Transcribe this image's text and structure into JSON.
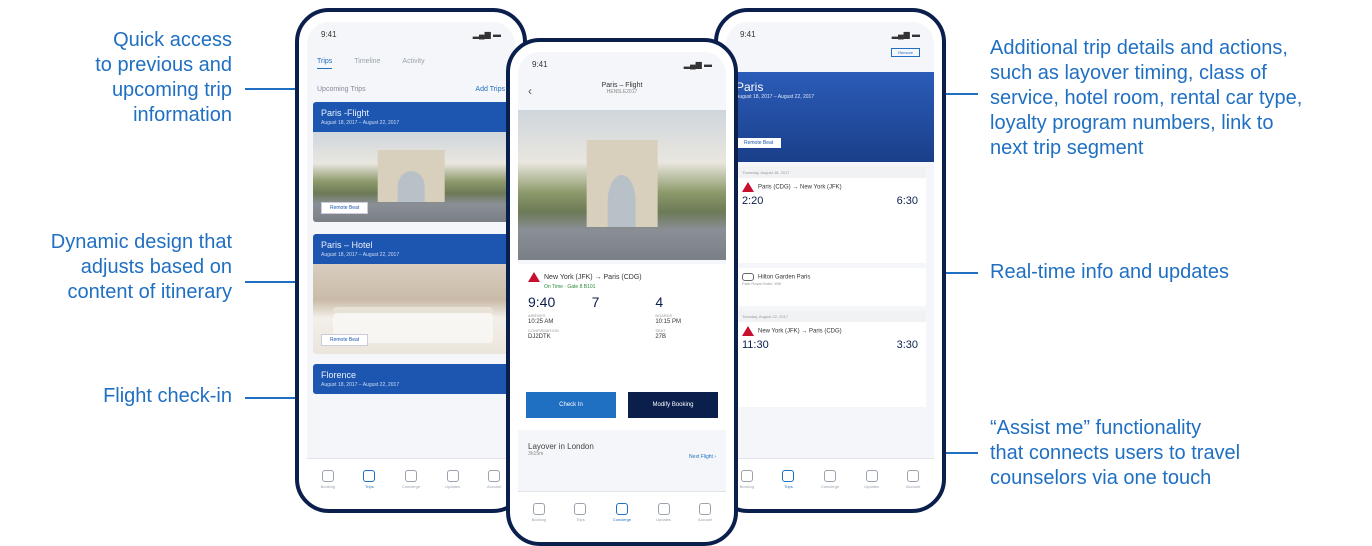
{
  "callouts": {
    "quick_access": "Quick access\nto previous and\nupcoming trip\ninformation",
    "dynamic_design": "Dynamic design that\nadjusts based on\ncontent of itinerary",
    "flight_checkin": "Flight check-in",
    "additional_details": "Additional trip details and actions,\nsuch as layover timing, class of\nservice, hotel room, rental car type,\nloyalty program numbers, link to\nnext trip segment",
    "realtime": "Real-time info and updates",
    "assist_me": "“Assist me” functionality\nthat connects users to travel\ncounselors via one touch"
  },
  "colors": {
    "accent": "#1f6fc2",
    "navy": "#0b1f4d",
    "card_blue": "#1d56b0",
    "delta_red": "#c8102e"
  },
  "phone1": {
    "time": "9:41",
    "tabs": [
      "Trips",
      "Timeline",
      "Activity"
    ],
    "section": "Upcoming Trips",
    "section_action": "Add Trips",
    "cards": [
      {
        "title": "Paris -Flight",
        "dates": "August 18, 2017 – August 22, 2017",
        "pill": "Remote Beat"
      },
      {
        "title": "Paris – Hotel",
        "dates": "August 18, 2017 – August 22, 2017",
        "pill": "Remote Beat"
      },
      {
        "title": "Florence",
        "dates": "August 18, 2017 – August 22, 2017"
      }
    ],
    "nav": [
      "Booking",
      "Trips",
      "Concierge",
      "Updates",
      "Account"
    ]
  },
  "phone2": {
    "time": "9:41",
    "title": "Paris – Flight",
    "subtitle": "HEN5LE2017",
    "route": "New York (JFK) → Paris (CDG)",
    "status": "On Time · Gate 8 B101",
    "depart_time": "9:40",
    "terminal": "7",
    "gate": "4",
    "fields": [
      {
        "label": "ARRIVES",
        "value": "10:25 AM"
      },
      {
        "label": "BOARDS",
        "value": "10:15 PM"
      },
      {
        "label": "CONFIRMATION",
        "value": "DJ2DTK"
      },
      {
        "label": "SEAT",
        "value": "27B"
      }
    ],
    "btn_checkin": "Check In",
    "btn_modify": "Modify Booking",
    "layover_title": "Layover in London",
    "layover_sub": "3h15m",
    "layover_action": "Next Flight ›",
    "nav": [
      "Booking",
      "Trips",
      "Concierge",
      "Updates",
      "Account"
    ]
  },
  "phone3": {
    "time": "9:41",
    "remove": "Remove",
    "banner_title": "Paris",
    "banner_dates": "August 18, 2017 – August 22, 2017",
    "banner_pill": "Remote Beat",
    "seg1": {
      "date": "Thursday, August 18, 2017",
      "route": "Paris (CDG) → New York (JFK)",
      "dep": "2:20",
      "arr": "6:30"
    },
    "hotel": {
      "name": "Hilton Garden Paris",
      "sub": "Park Royal Hotel, Wifi"
    },
    "seg2": {
      "date": "Tuesday, August 22, 2017",
      "route": "New York (JFK) → Paris (CDG)",
      "dep": "11:30",
      "arr": "3:30"
    },
    "nav": [
      "Booking",
      "Trips",
      "Concierge",
      "Updates",
      "Account"
    ]
  }
}
